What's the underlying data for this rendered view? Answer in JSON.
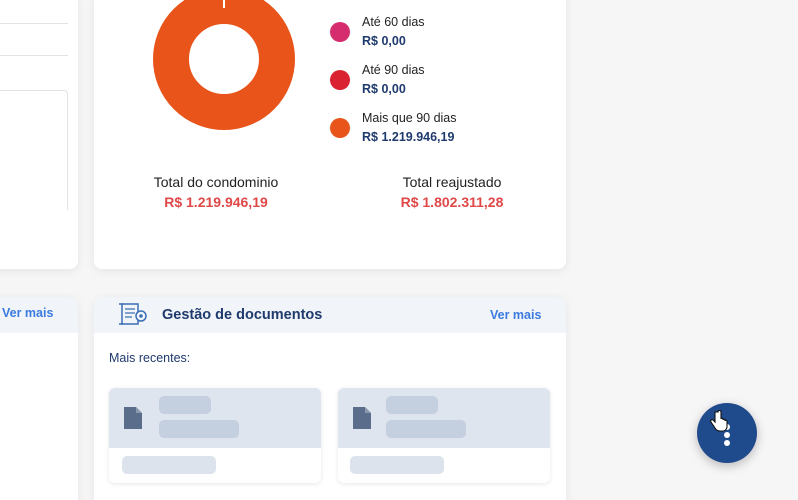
{
  "pending": {
    "legend": [
      {
        "label": "Até 60 dias",
        "value": "R$ 0,00",
        "color": "#d62d6f"
      },
      {
        "label": "Até 90 dias",
        "value": "R$ 0,00",
        "color": "#d92330"
      },
      {
        "label": "Mais que 90 dias",
        "value": "R$ 1.219.946,19",
        "color": "#e8541a"
      }
    ],
    "donut_color": "#e8541a",
    "total_condominio": {
      "label": "Total do condominio",
      "value": "R$ 1.219.946,19"
    },
    "total_reajustado": {
      "label": "Total reajustado",
      "value": "R$ 1.802.311,28"
    }
  },
  "left_card": {
    "ver_mais": "Ver mais"
  },
  "documents": {
    "title": "Gestão de documentos",
    "ver_mais": "Ver mais",
    "recent_label": "Mais recentes:"
  },
  "fab": {
    "icon": "more-vertical-icon"
  },
  "colors": {
    "accent": "#3b7be0",
    "navy": "#1f3a6d",
    "alert": "#e04848",
    "fab": "#1f4a8c"
  }
}
